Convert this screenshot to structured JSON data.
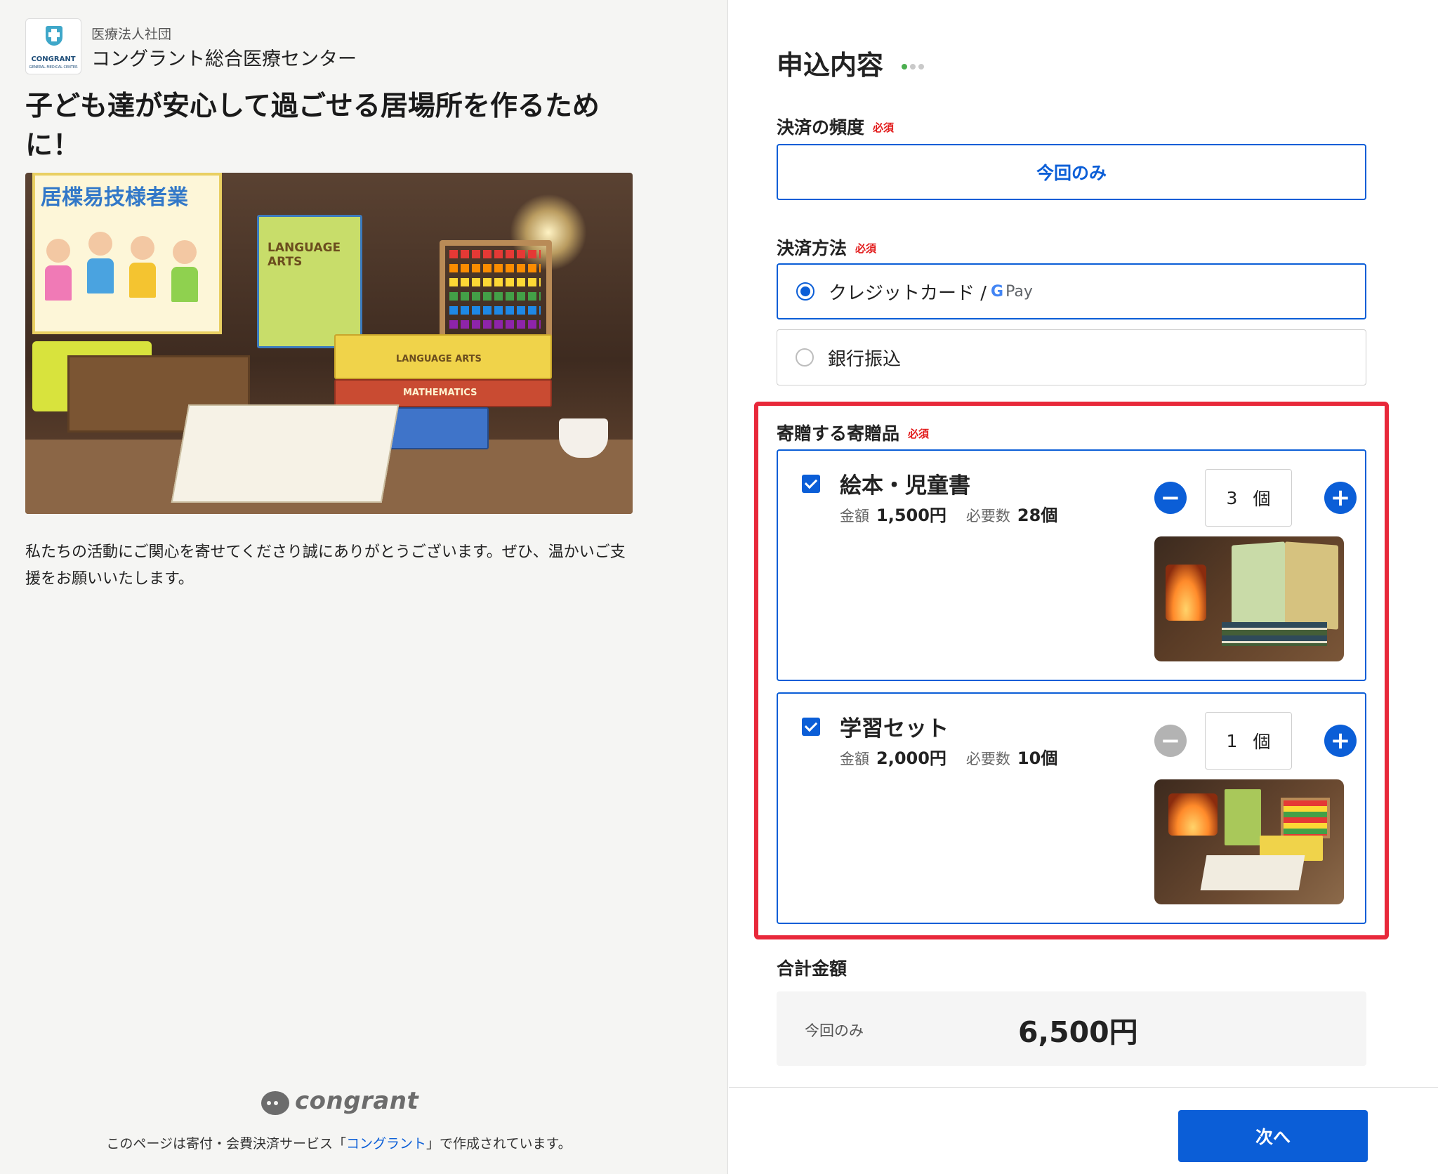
{
  "org": {
    "type": "医療法人社団",
    "name": "コングラント総合医療センター",
    "logo_text": "CONGRANT",
    "logo_subtext": "GENERAL MEDICAL CENTER"
  },
  "campaign": {
    "title": "子ども達が安心して過ごせる居場所を作るために！",
    "hero_image": {
      "poster_text": "居楪易技様者業",
      "book_labels": [
        "LANGUAGE ARTS",
        "LANGUAGE ARTS",
        "MATHEMATICS"
      ]
    },
    "description": "私たちの活動にご関心を寄せてくださり誠にありがとうございます。ぜひ、温かいご支援をお願いいたします。"
  },
  "footer": {
    "brand": "congrant",
    "note_prefix": "このページは寄付・会費決済サービス「",
    "note_link": "コングラント",
    "note_suffix": "」で作成されています。"
  },
  "form": {
    "title": "申込内容",
    "required_badge": "必須",
    "frequency": {
      "label": "決済の頻度",
      "selected": "今回のみ"
    },
    "payment": {
      "label": "決済方法",
      "options": [
        {
          "label": "クレジットカード /",
          "suffix": "Pay",
          "suffix_icon": "google-g-icon",
          "selected": true
        },
        {
          "label": "銀行振込",
          "selected": false
        }
      ]
    },
    "gifts": {
      "label": "寄贈する寄贈品",
      "price_label": "金額",
      "need_label": "必要数",
      "unit": "個",
      "items": [
        {
          "name": "絵本・児童書",
          "price": "1,500円",
          "need": "28個",
          "qty": "3",
          "checked": true,
          "minus_enabled": true,
          "image": "picture-books-image"
        },
        {
          "name": "学習セット",
          "price": "2,000円",
          "need": "10個",
          "qty": "1",
          "checked": true,
          "minus_enabled": false,
          "image": "study-set-image"
        }
      ]
    },
    "total": {
      "label": "合計金額",
      "frequency": "今回のみ",
      "amount": "6,500円"
    },
    "next_button": "次へ"
  },
  "colors": {
    "accent": "#0b5ed7",
    "highlight": "#e8283a",
    "required": "#e21b1b",
    "step_active": "#4caf50"
  }
}
